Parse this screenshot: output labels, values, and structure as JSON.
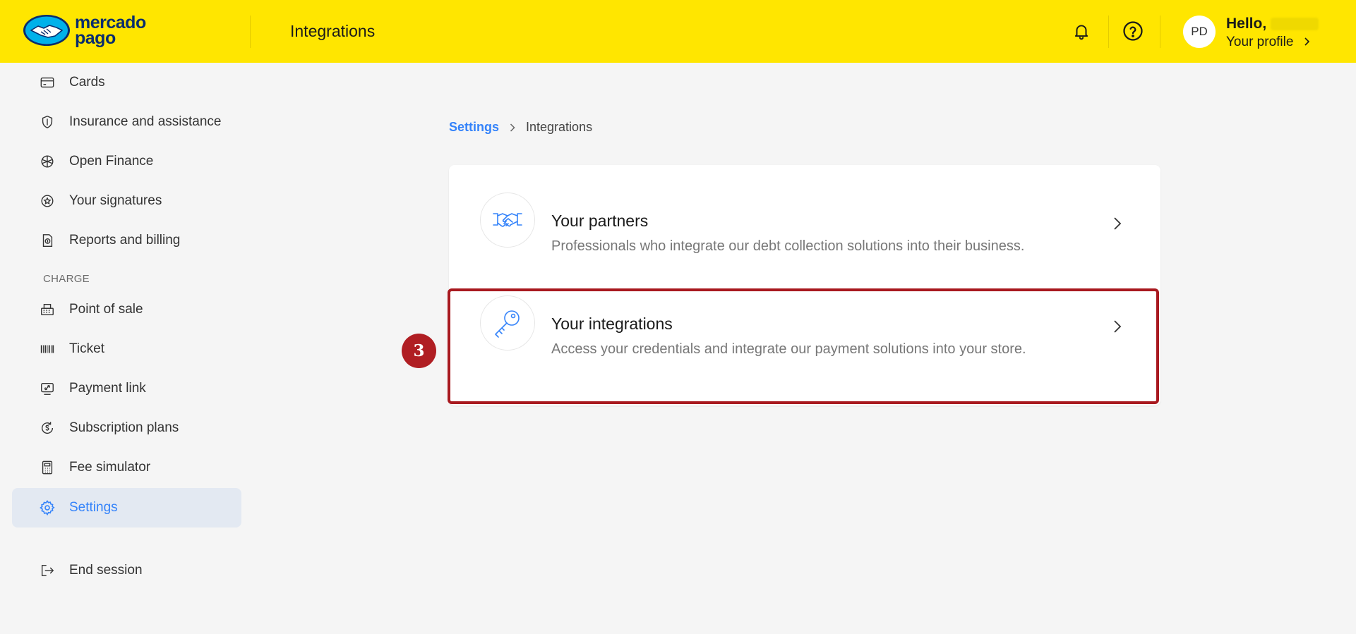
{
  "header": {
    "brand": "mercado pago",
    "brand_line1": "mercado",
    "brand_line2": "pago",
    "title": "Integrations",
    "avatar_initials": "PD",
    "greeting": "Hello,",
    "profile_link": "Your profile",
    "icons": [
      "bell-icon",
      "help-icon",
      "chevron-right-icon"
    ]
  },
  "sidebar": {
    "items_top": [
      {
        "label": "Cards",
        "icon": "card-icon"
      },
      {
        "label": "Insurance and assistance",
        "icon": "shield-icon"
      },
      {
        "label": "Open Finance",
        "icon": "open-finance-icon"
      },
      {
        "label": "Your signatures",
        "icon": "signature-badge-icon"
      },
      {
        "label": "Reports and billing",
        "icon": "report-icon"
      }
    ],
    "section_label": "CHARGE",
    "items_charge": [
      {
        "label": "Point of sale",
        "icon": "cash-register-icon"
      },
      {
        "label": "Ticket",
        "icon": "barcode-icon"
      },
      {
        "label": "Payment link",
        "icon": "payment-link-icon"
      },
      {
        "label": "Subscription plans",
        "icon": "subscription-icon"
      },
      {
        "label": "Fee simulator",
        "icon": "calculator-icon"
      },
      {
        "label": "Settings",
        "icon": "gear-icon",
        "active": true
      }
    ],
    "end_session": {
      "label": "End session",
      "icon": "logout-icon"
    }
  },
  "breadcrumb": {
    "parent": "Settings",
    "current": "Integrations"
  },
  "options": [
    {
      "title": "Your partners",
      "description": "Professionals who integrate our debt collection solutions into their business.",
      "icon": "handshake-icon"
    },
    {
      "title": "Your integrations",
      "description": "Access your credentials and integrate our payment solutions into your store.",
      "icon": "key-icon"
    }
  ],
  "annotation": {
    "step_number": "3"
  },
  "colors": {
    "header_bg": "#ffe600",
    "accent": "#3483fa",
    "active_bg": "#e3e9f2",
    "highlight": "#a8191f",
    "brand_navy": "#0a2d6e"
  }
}
